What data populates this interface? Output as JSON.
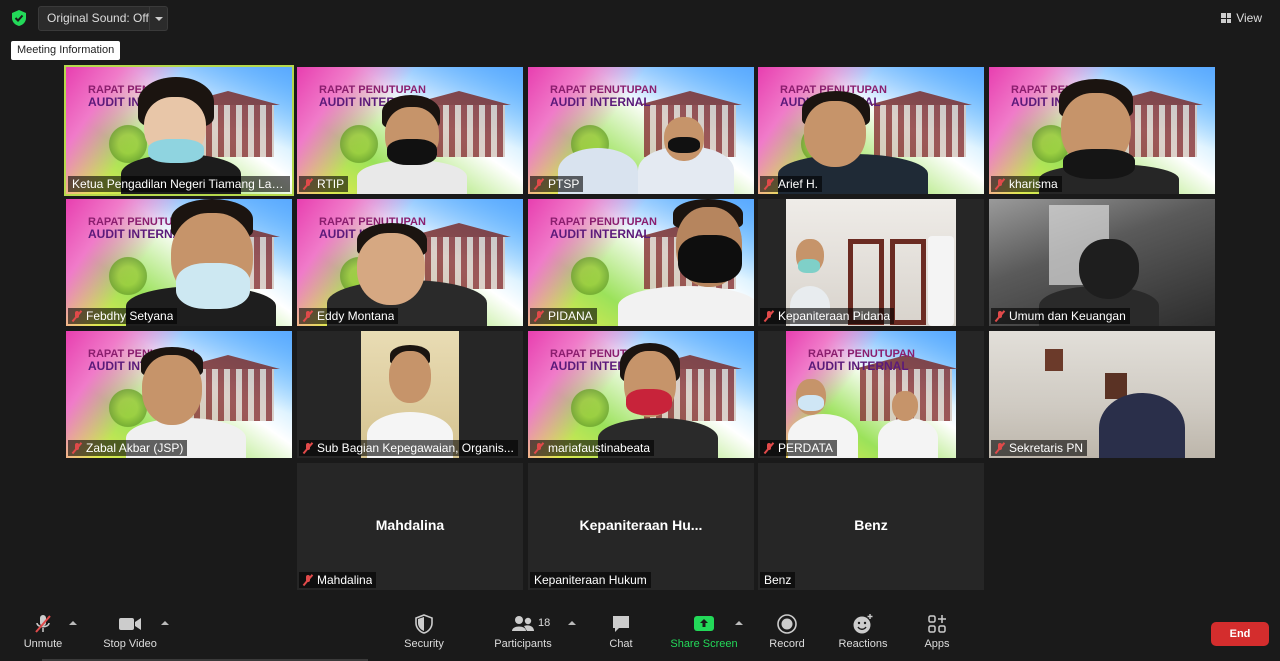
{
  "topbar": {
    "security_status_icon": "shield-check-icon",
    "original_sound_label": "Original Sound: Off",
    "tooltip": "Meeting Information",
    "view_label": "View"
  },
  "banner_text": {
    "line1": "RAPAT PENUTUPAN",
    "line2": "AUDIT INTERNAL"
  },
  "tiles": [
    {
      "name": "Ketua Pengadilan Negeri Tiamang Lay...",
      "muted": false
    },
    {
      "name": "RTIP",
      "muted": true
    },
    {
      "name": "PTSP",
      "muted": true
    },
    {
      "name": "Arief H.",
      "muted": true
    },
    {
      "name": "kharisma",
      "muted": true
    },
    {
      "name": "Febdhy Setyana",
      "muted": true
    },
    {
      "name": "Eddy Montana",
      "muted": true
    },
    {
      "name": "PIDANA",
      "muted": true
    },
    {
      "name": "Kepaniteraan Pidana",
      "muted": true
    },
    {
      "name": "Umum dan Keuangan",
      "muted": true
    },
    {
      "name": "Zabal Akbar (JSP)",
      "muted": true
    },
    {
      "name": "Sub Bagian Kepegawaian, Organis...",
      "muted": true
    },
    {
      "name": "mariafaustinabeata",
      "muted": true
    },
    {
      "name": "PERDATA",
      "muted": true
    },
    {
      "name": "Sekretaris PN",
      "muted": true
    },
    {
      "name": "Mahdalina",
      "center": "Mahdalina",
      "muted": true
    },
    {
      "name": "Kepaniteraan Hukum",
      "center": "Kepaniteraan  Hu...",
      "muted": false
    },
    {
      "name": "Benz",
      "center": "Benz",
      "muted": false
    }
  ],
  "toolbar": {
    "unmute": "Unmute",
    "stop_video": "Stop Video",
    "security": "Security",
    "participants": "Participants",
    "participant_count": "18",
    "chat": "Chat",
    "share_screen": "Share Screen",
    "record": "Record",
    "reactions": "Reactions",
    "apps": "Apps",
    "end": "End"
  },
  "colors": {
    "background": "#1a1a1a",
    "active_speaker": "#b6d94c",
    "share_green": "#23d959",
    "end_red": "#d42d2d",
    "muted_red": "#e04a4a"
  }
}
